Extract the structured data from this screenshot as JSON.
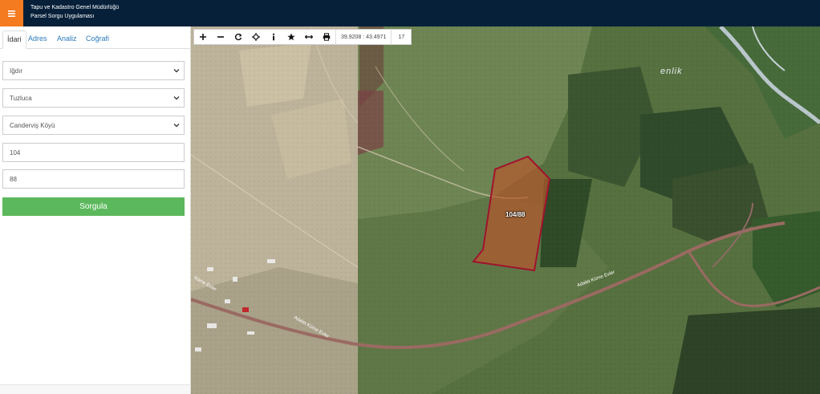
{
  "header": {
    "menu_icon": "hamburger-icon",
    "title_line1": "Tapu ve Kadastro Genel Müdürlüğü",
    "title_line2": "Parsel Sorgu Uygulaması",
    "colors": {
      "bar": "#062039",
      "menu": "#f47b20"
    }
  },
  "sidebar": {
    "tabs": [
      {
        "label": "İdari",
        "active": true
      },
      {
        "label": "Adres",
        "active": false
      },
      {
        "label": "Analiz",
        "active": false
      },
      {
        "label": "Coğrafi",
        "active": false
      }
    ],
    "form": {
      "province": "Iğdır",
      "district": "Tuzluca",
      "neighborhood": "Canderviş Köyü",
      "block": "104",
      "parcel": "88"
    },
    "query_button": "Sorgula",
    "colors": {
      "query_button": "#5cb85c",
      "tab_link": "#2a7bc0"
    }
  },
  "map": {
    "toolbar": {
      "icons": [
        "zoom-in-icon",
        "zoom-out-icon",
        "refresh-icon",
        "locate-icon",
        "info-icon",
        "star-icon",
        "measure-icon",
        "print-icon"
      ],
      "coordinates": "39.9208 : 43.4971",
      "zoom": "17"
    },
    "parcel_label": "104/88",
    "road_label_1": "Adalet Küme Evler",
    "road_label_2": "Adalet Küme Evler",
    "road_label_3": "Küme Evler",
    "place_label": "enlik",
    "colors": {
      "parcel_fill": "#b5582e",
      "parcel_stroke": "#a0122e"
    }
  }
}
